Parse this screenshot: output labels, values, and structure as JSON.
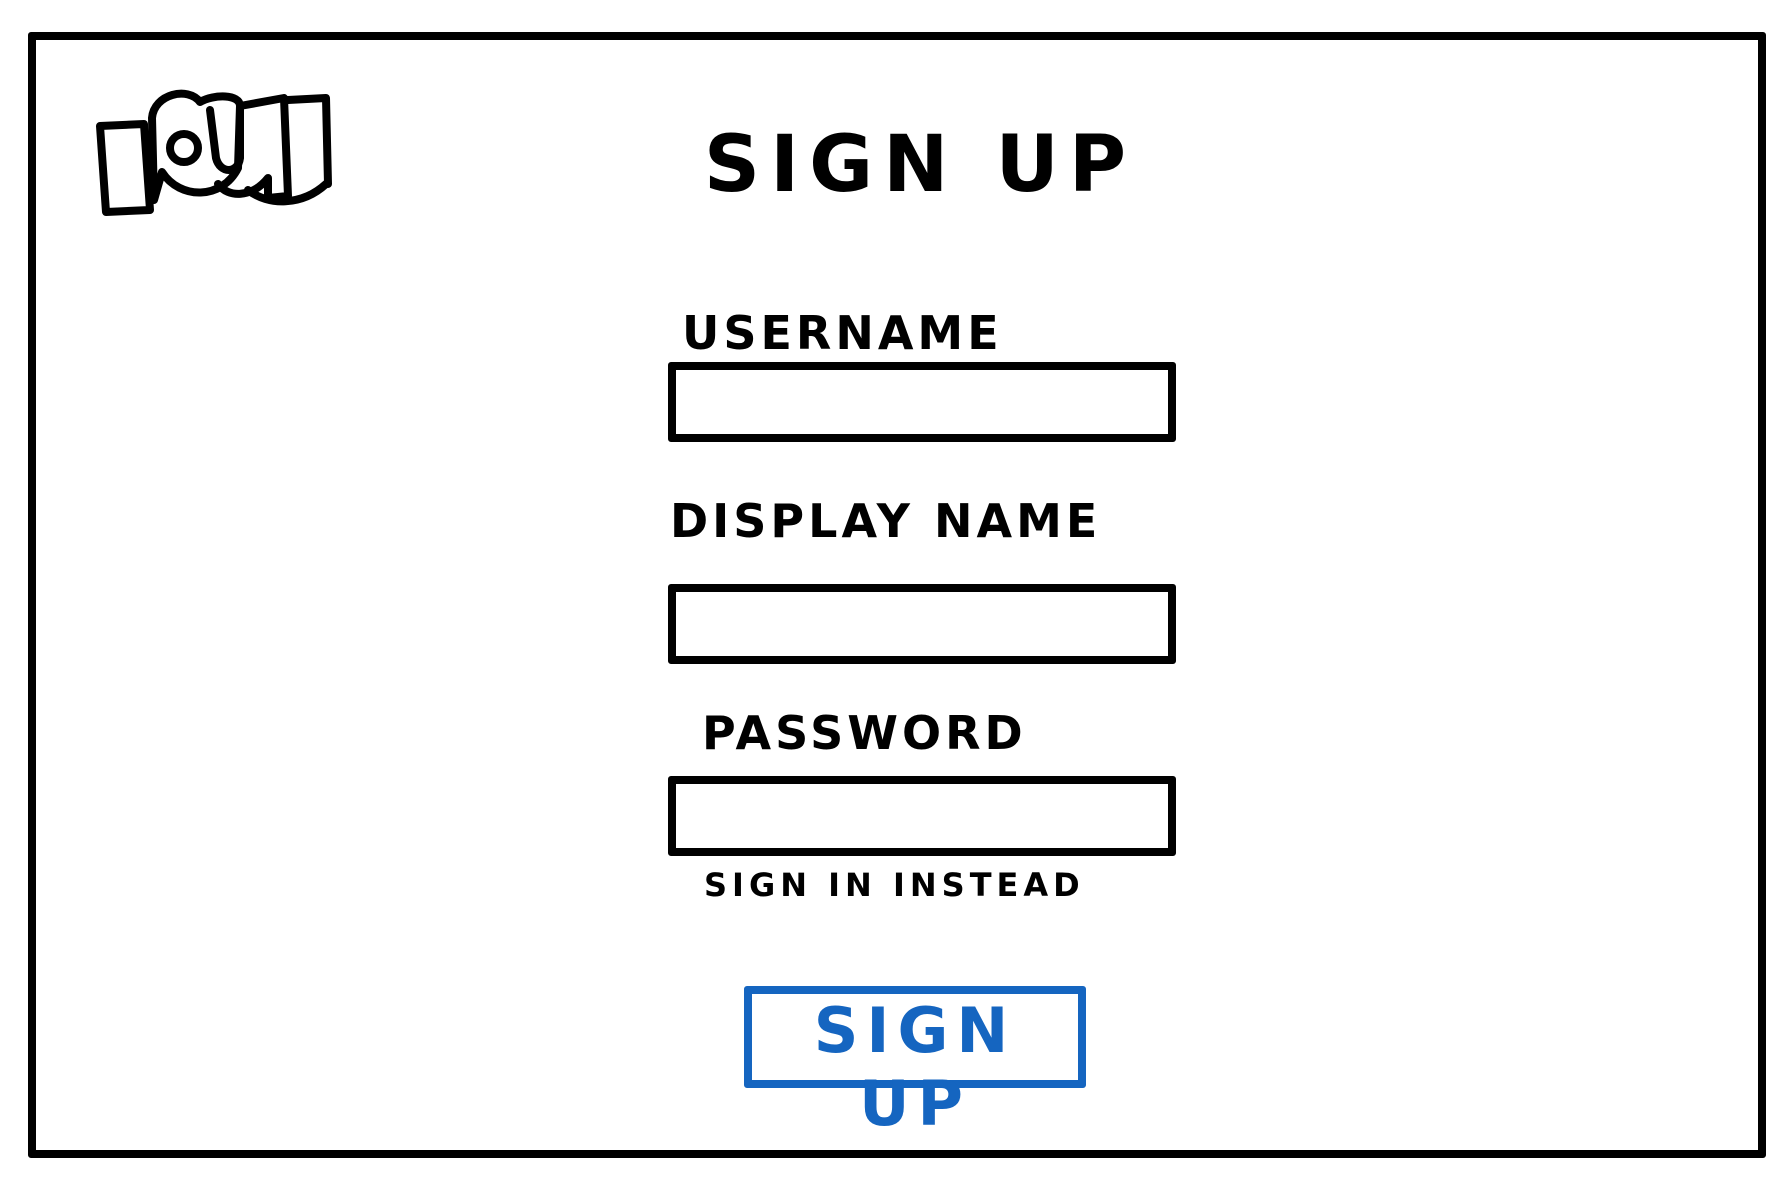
{
  "logo": {
    "text": "IOU",
    "icon": "iou-logo-icon"
  },
  "page": {
    "title": "SIGN UP"
  },
  "form": {
    "username": {
      "label": "USERNAME",
      "value": "",
      "placeholder": ""
    },
    "display_name": {
      "label": "DISPLAY NAME",
      "value": "",
      "placeholder": ""
    },
    "password": {
      "label": "PASSWORD",
      "value": "",
      "placeholder": ""
    },
    "sign_in_link": "SIGN IN INSTEAD",
    "submit_label": "SIGN UP"
  },
  "colors": {
    "primary": "#1565c0",
    "ink": "#000000",
    "background": "#ffffff"
  }
}
